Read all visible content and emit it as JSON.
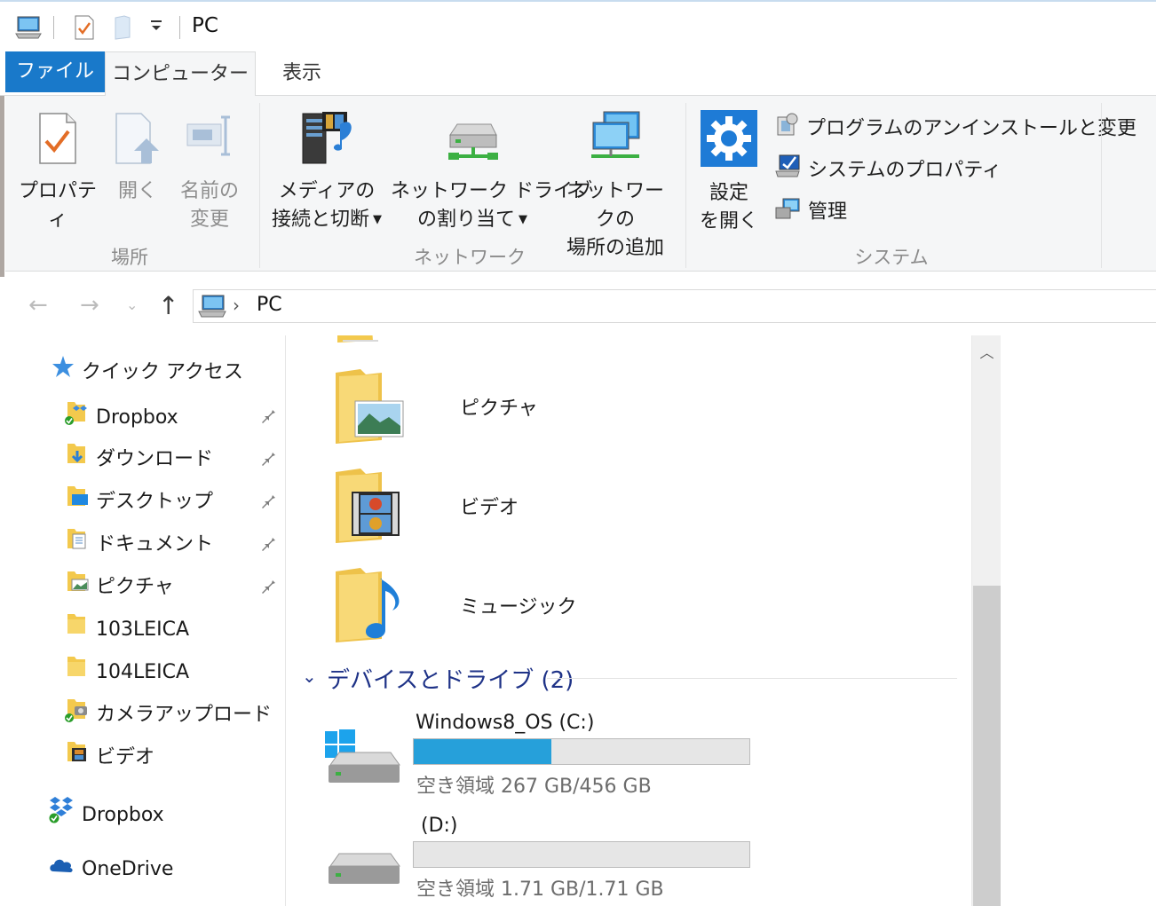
{
  "window": {
    "title": "PC"
  },
  "quick_access_toolbar": {
    "icons": [
      "computer-icon",
      "properties-check-icon",
      "new-folder-icon",
      "customize-dropdown-icon"
    ]
  },
  "ribbon_tabs": {
    "file": "ファイル",
    "computer": "コンピューター",
    "view": "表示"
  },
  "ribbon": {
    "location": {
      "label": "場所",
      "properties": "プロパティ",
      "open": "開く",
      "rename_line1": "名前の",
      "rename_line2": "変更"
    },
    "network": {
      "label": "ネットワーク",
      "media_line1": "メディアの",
      "media_line2": "接続と切断",
      "map_drive_line1": "ネットワーク ドライブ",
      "map_drive_line2": "の割り当て",
      "add_location_line1": "ネットワークの",
      "add_location_line2": "場所の追加"
    },
    "system": {
      "label": "システム",
      "settings_line1": "設定",
      "settings_line2": "を開く",
      "uninstall": "プログラムのアンインストールと変更",
      "system_properties": "システムのプロパティ",
      "manage": "管理"
    }
  },
  "address_bar": {
    "location": "PC"
  },
  "nav_pane": {
    "quick_access": "クイック アクセス",
    "items": [
      {
        "label": "Dropbox",
        "pinned": true
      },
      {
        "label": "ダウンロード",
        "pinned": true
      },
      {
        "label": "デスクトップ",
        "pinned": true
      },
      {
        "label": "ドキュメント",
        "pinned": true
      },
      {
        "label": "ピクチャ",
        "pinned": true
      },
      {
        "label": "103LEICA",
        "pinned": false
      },
      {
        "label": "104LEICA",
        "pinned": false
      },
      {
        "label": "カメラアップロード",
        "pinned": false
      },
      {
        "label": "ビデオ",
        "pinned": false
      }
    ],
    "dropbox": "Dropbox",
    "onedrive": "OneDrive"
  },
  "folders": [
    {
      "name": "ピクチャ",
      "icon": "pictures-folder-icon"
    },
    {
      "name": "ビデオ",
      "icon": "videos-folder-icon"
    },
    {
      "name": "ミュージック",
      "icon": "music-folder-icon"
    }
  ],
  "devices_section": {
    "label": "デバイスとドライブ (2)"
  },
  "drives": [
    {
      "name": "Windows8_OS (C:)",
      "free_text": "空き領域 267 GB/456 GB",
      "used_fraction": 0.41
    },
    {
      "name": "(D:)",
      "free_text": "空き領域 1.71 GB/1.71 GB",
      "used_fraction": 0.0
    }
  ],
  "colors": {
    "accent": "#1979ca",
    "drive_fill": "#26a0da",
    "section_heading": "#1e3287"
  }
}
